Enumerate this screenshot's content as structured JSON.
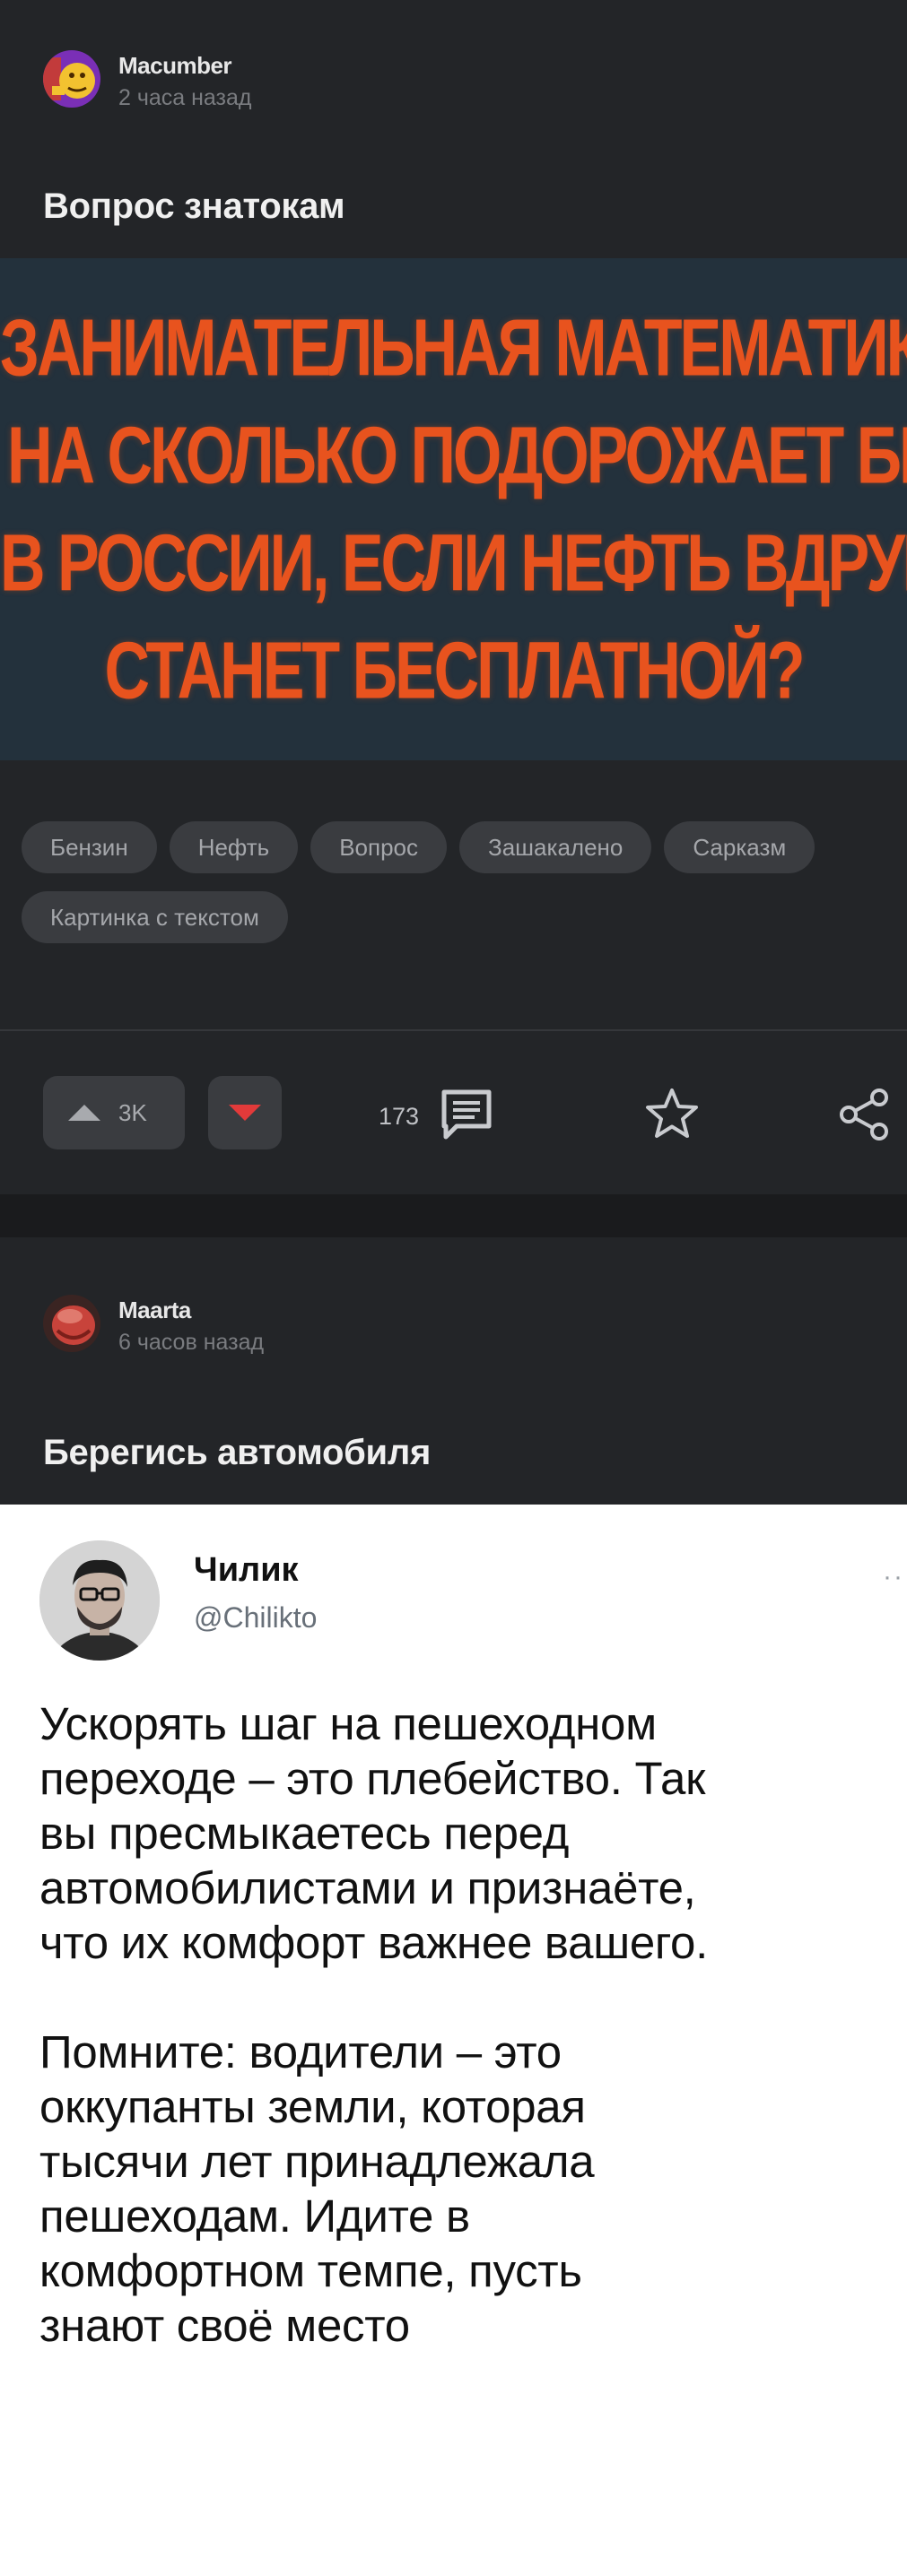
{
  "post1": {
    "author_name": "Macumber",
    "author_time": "2 часа назад",
    "title": "Вопрос знатокам",
    "meme_lines": [
      "ЗАНИМАТЕЛЬНАЯ МАТЕМАТИКА:",
      "НА СКОЛЬКО ПОДОРОЖАЕТ БЕНЗИН",
      "В РОССИИ, ЕСЛИ НЕФТЬ ВДРУГ",
      "СТАНЕТ БЕСПЛАТНОЙ?"
    ],
    "tags": [
      "Бензин",
      "Нефть",
      "Вопрос",
      "Зашакалено",
      "Сарказм",
      "Картинка с текстом"
    ],
    "rating": "3K",
    "comments_count": "173",
    "icons": {
      "upvote": "triangle-up-icon",
      "downvote": "triangle-down-icon",
      "comments": "comment-icon",
      "save": "star-icon",
      "share": "share-icon"
    }
  },
  "post2": {
    "author_name": "Maarta",
    "author_time": "6 часов назад",
    "title": "Берегись автомобиля",
    "tweet": {
      "name": "Чилик",
      "handle": "@Chilikto",
      "more": "··",
      "paragraph1": "Ускорять шаг на пешеходном\nпереходе – это плебейство. Так\nвы пресмыкаетесь перед\nавтомобилистами и признаёте,\nчто их комфорт важнее вашего.",
      "paragraph2": "Помните: водители – это\nоккупанты земли, которая\nтысячи лет принадлежала\nпешеходам. Идите в\nкомфортном темпе, пусть\nзнают своё место"
    }
  },
  "colors": {
    "background": "#232528",
    "meme_text": "#e8531e",
    "meme_bg": "#23313c",
    "downvote": "#e23a3a"
  }
}
